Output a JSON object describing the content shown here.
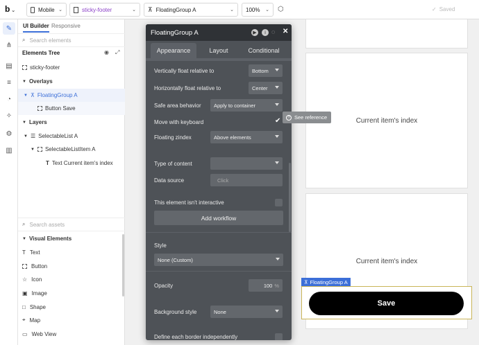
{
  "topbar": {
    "logo": "b",
    "device": "Mobile",
    "page": "sticky-footer",
    "element": "FloatingGroup A",
    "zoom": "100%",
    "saved": "Saved"
  },
  "panel": {
    "tab_builder": "UI Builder",
    "tab_responsive": "Responsive",
    "search_elements": "Search elements",
    "tree_title": "Elements Tree",
    "tree": {
      "root": "sticky-footer",
      "overlays": "Overlays",
      "floating_group": "FloatingGroup A",
      "button_save": "Button Save",
      "layers": "Layers",
      "selectable_list": "SelectableList A",
      "selectable_list_item": "SelectableListItem A",
      "text_index": "Text Current item's index"
    },
    "search_assets": "Search assets",
    "visual_elements": "Visual Elements",
    "visual_items": [
      "Text",
      "Button",
      "Icon",
      "Image",
      "Shape",
      "Map",
      "Web View"
    ]
  },
  "canvas": {
    "item1": "Current item's index",
    "item2": "Current item's index",
    "fg_tag": "FloatingGroup A",
    "save": "Save"
  },
  "editor": {
    "title": "FloatingGroup A",
    "tabs": [
      "Appearance",
      "Layout",
      "Conditional"
    ],
    "vfloat_label": "Vertically float relative to",
    "vfloat_value": "Bottom",
    "hfloat_label": "Horizontally float relative to",
    "hfloat_value": "Center",
    "safe_label": "Safe area behavior",
    "safe_value": "Apply to container",
    "keyboard_label": "Move with keyboard",
    "keyboard_checked": true,
    "zindex_label": "Floating zindex",
    "zindex_value": "Above elements",
    "content_label": "Type of content",
    "content_value": "",
    "source_label": "Data source",
    "source_placeholder": "Click",
    "interactive_label": "This element isn't interactive",
    "workflow": "Add workflow",
    "style_label": "Style",
    "style_value": "None (Custom)",
    "opacity_label": "Opacity",
    "opacity_value": "100",
    "opacity_unit": "%",
    "bg_label": "Background style",
    "bg_value": "None",
    "border_label": "Define each border independently"
  },
  "tooltip": {
    "see_reference": "See reference"
  }
}
